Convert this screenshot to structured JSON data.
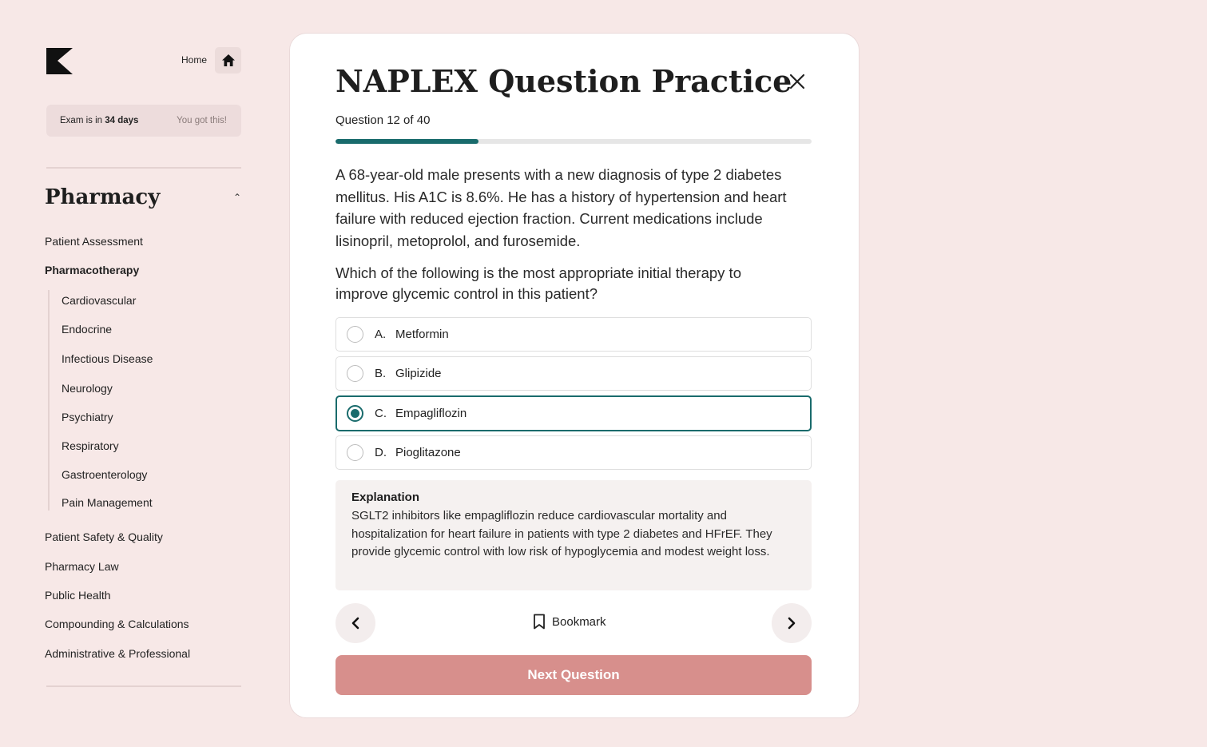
{
  "sidebar": {
    "home_label": "Home",
    "exam_banner": {
      "prefix": "Exam is in",
      "days": "34 days",
      "encouragement": "You got this!"
    },
    "section_title": "Pharmacy",
    "items": [
      {
        "label": "Patient Assessment"
      },
      {
        "label": "Pharmacotherapy",
        "active": true
      },
      {
        "label": "Patient Safety & Quality"
      },
      {
        "label": "Pharmacy Law"
      },
      {
        "label": "Public Health"
      },
      {
        "label": "Compounding & Calculations"
      },
      {
        "label": "Administrative & Professional"
      }
    ],
    "subitems": [
      {
        "label": "Cardiovascular"
      },
      {
        "label": "Endocrine"
      },
      {
        "label": "Infectious Disease"
      },
      {
        "label": "Neurology"
      },
      {
        "label": "Psychiatry"
      },
      {
        "label": "Respiratory"
      },
      {
        "label": "Gastroenterology"
      },
      {
        "label": "Pain Management"
      }
    ]
  },
  "card": {
    "title": "NAPLEX Question Practice",
    "question_count": "Question 12 of 40",
    "progress": 0.3,
    "stem": "A 68-year-old male presents with a new diagnosis of type 2 diabetes mellitus. His A1C is 8.6%. He has a history of hypertension and heart failure with reduced ejection fraction. Current medications include lisinopril, metoprolol, and furosemide.",
    "question": "Which of the following is the most appropriate initial therapy to improve glycemic control in this patient?",
    "options": [
      {
        "letter": "A.",
        "text": "Metformin",
        "selected": false
      },
      {
        "letter": "B.",
        "text": "Glipizide",
        "selected": false
      },
      {
        "letter": "C.",
        "text": "Empagliflozin",
        "selected": true
      },
      {
        "letter": "D.",
        "text": "Pioglitazone",
        "selected": false
      }
    ],
    "explanation": {
      "title": "Explanation",
      "text": "SGLT2 inhibitors like empagliflozin reduce cardiovascular mortality and hospitalization for heart failure in patients with type 2 diabetes and HFrEF. They provide glycemic control with low risk of hypoglycemia and modest weight loss."
    },
    "bookmark_label": "Bookmark",
    "next_label": "Next Question"
  },
  "colors": {
    "background": "#f7e8e7",
    "accent": "#196b6c",
    "next_button": "#d78f8c"
  }
}
